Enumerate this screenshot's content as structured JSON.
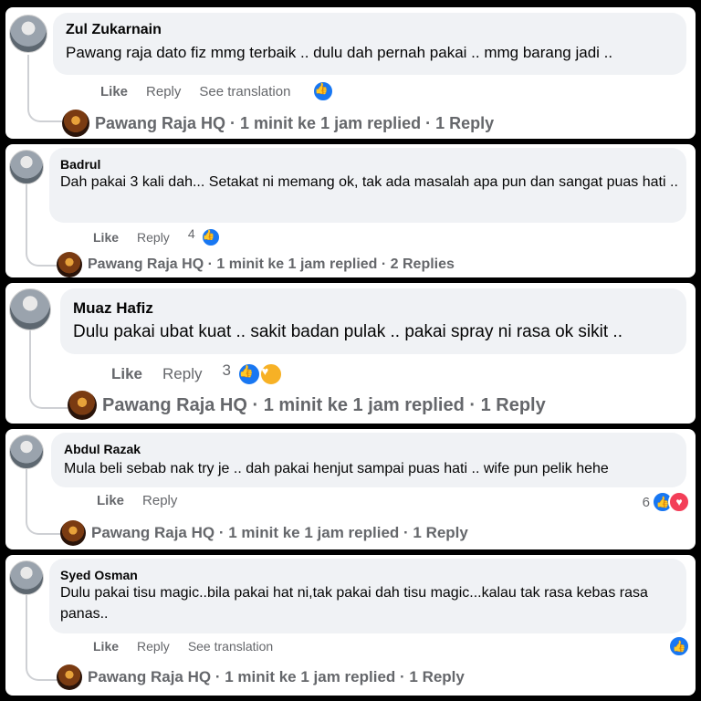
{
  "accent_color": "#1877f2",
  "comments": [
    {
      "name": "Zul Zukarnain",
      "text": "Pawang raja dato fiz mmg terbaik .. dulu dah pernah pakai .. mmg barang jadi ..",
      "like": "Like",
      "reply": "Reply",
      "translate": "See translation",
      "count": "",
      "reactions": [
        "like"
      ],
      "reply_summary": "Pawang Raja HQ · 1 minit ke 1 jam replied · 1 Reply"
    },
    {
      "name": "Badrul",
      "text": "Dah pakai 3 kali dah... Setakat ni memang ok, tak ada masalah apa pun dan sangat puas hati ..",
      "like": "Like",
      "reply": "Reply",
      "translate": "",
      "count": "4",
      "reactions": [
        "like"
      ],
      "reply_summary": "Pawang Raja HQ · 1 minit ke 1 jam replied · 2 Replies"
    },
    {
      "name": "Muaz Hafiz",
      "text": "Dulu pakai ubat kuat .. sakit badan pulak .. pakai spray ni rasa ok sikit ..",
      "like": "Like",
      "reply": "Reply",
      "translate": "",
      "count": "3",
      "reactions": [
        "like",
        "care"
      ],
      "reply_summary": "Pawang Raja HQ · 1 minit ke 1 jam replied · 1 Reply"
    },
    {
      "name": "Abdul Razak",
      "text": "Mula beli sebab nak try je .. dah pakai henjut sampai puas hati .. wife pun pelik hehe",
      "like": "Like",
      "reply": "Reply",
      "translate": "",
      "count": "6",
      "reactions": [
        "like",
        "love"
      ],
      "reply_summary": "Pawang Raja HQ · 1 minit ke 1 jam replied · 1 Reply"
    },
    {
      "name": "Syed Osman",
      "text": "Dulu pakai tisu magic..bila pakai hat ni,tak pakai dah tisu magic...kalau tak rasa kebas rasa panas..",
      "like": "Like",
      "reply": "Reply",
      "translate": "See translation",
      "count": "",
      "reactions": [
        "like"
      ],
      "reply_summary": "Pawang Raja HQ · 1 minit ke 1 jam replied · 1 Reply"
    }
  ]
}
